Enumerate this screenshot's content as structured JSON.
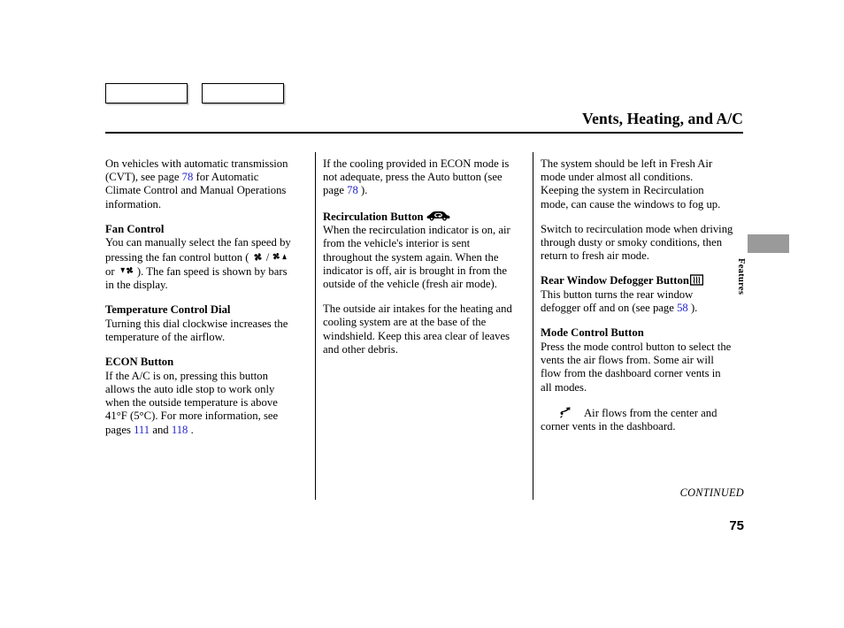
{
  "header": {
    "title": "Vents, Heating, and A/C",
    "nav_buttons": [
      {
        "label": "",
        "name": "nav-button-left"
      },
      {
        "label": "",
        "name": "nav-button-right"
      }
    ]
  },
  "columns": {
    "col1": {
      "para1_a": "On vehicles with automatic transmission (CVT), see page ",
      "para1_link": "78",
      "para1_b": " for Automatic Climate Control and Manual Operations information.",
      "heading_fan": "Fan Control",
      "fan_a": "You can manually select the fan speed by pressing the fan control button ( ",
      "fan_sep": " / ",
      "fan_or": " or ",
      "fan_b": " ). The fan speed is shown by bars in the display.",
      "heading_temp": "Temperature Control Dial",
      "temp_body": "Turning this dial clockwise increases the temperature of the airflow.",
      "heading_econ": "ECON Button",
      "econ_a": "If the A/C is on, pressing this button allows the auto idle stop to work only when the outside temperature is above 41°F (5°C). For more information, see pages ",
      "econ_link1": "111",
      "econ_mid": " and ",
      "econ_link2": "118",
      "econ_b": " ."
    },
    "col2": {
      "para1_a": "If the cooling provided in ECON mode is not adequate, press the Auto button (see page ",
      "para1_link": "78",
      "para1_b": " ).",
      "heading_recirc": "Recirculation Button",
      "recirc_body": "When the recirculation indicator is on, air from the vehicle's interior is sent throughout the system again. When the indicator is off, air is brought in from the outside of the vehicle (fresh air mode).",
      "intake_body": "The outside air intakes for the heating and cooling system are at the base of the windshield. Keep this area clear of leaves and other debris."
    },
    "col3": {
      "para1": "The system should be left in Fresh Air mode under almost all conditions. Keeping the system in Recirculation mode, can cause the windows to fog up.",
      "para2": "Switch to recirculation mode when driving through dusty or smoky conditions, then return to fresh air mode.",
      "heading_defog": "Rear Window Defogger Button",
      "defog_a": "This button turns the rear window defogger off and on (see page ",
      "defog_link": "58",
      "defog_b": " ).",
      "heading_mode": "Mode Control Button",
      "mode_body": "Press the mode control button to select the vents the air flows from. Some air will flow from the dashboard corner vents in all modes.",
      "airflow_body": "Air flows from the center and corner vents in the dashboard."
    }
  },
  "side_tab": {
    "label": "Features",
    "color": "#9a9a9a"
  },
  "footer": {
    "continued": "CONTINUED",
    "page_number": "75"
  },
  "icons": {
    "fan": "fan-icon",
    "fan_up": "fan-increase-icon",
    "fan_down": "fan-decrease-icon",
    "recirculation": "recirculation-car-icon",
    "defogger": "rear-defogger-icon",
    "airflow": "airflow-dashboard-icon"
  },
  "colors": {
    "link": "#2323cc",
    "text": "#000000",
    "tab": "#9a9a9a"
  }
}
